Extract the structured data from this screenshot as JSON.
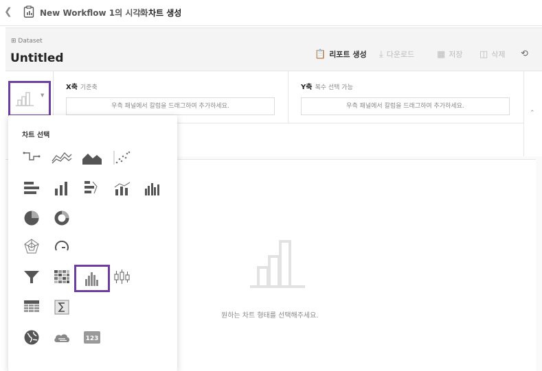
{
  "header": {
    "title": "New Workflow 1의 시각화",
    "separator": "/",
    "page": "차트 생성"
  },
  "dataset": {
    "label": "Dataset",
    "name": "Untitled"
  },
  "toolbar": {
    "report": "리포트 생성",
    "download": "다운로드",
    "save": "저장",
    "delete": "삭제"
  },
  "xaxis": {
    "title": "X축",
    "subtitle": "기준축",
    "placeholder": "우측 패널에서 칼럼을 드래그하여 추가하세요."
  },
  "yaxis": {
    "title": "Y축",
    "subtitle": "복수 선택 가능",
    "placeholder": "우측 패널에서 칼럼을 드래그하여 추가하세요."
  },
  "picker": {
    "title": "차트 선택",
    "selected": "histogram-chart"
  },
  "canvas": {
    "message": "원하는 차트 형태를 선택해주세요."
  },
  "badge": {
    "number": "123"
  }
}
